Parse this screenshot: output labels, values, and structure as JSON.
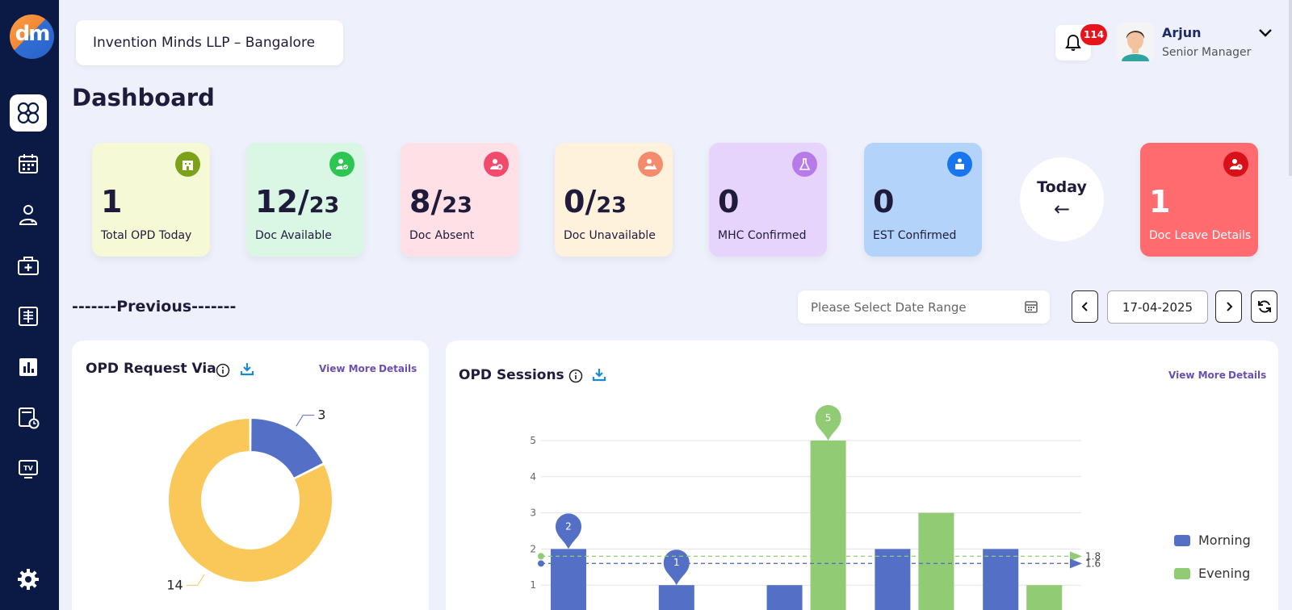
{
  "app": {
    "logo_text": "dm"
  },
  "header": {
    "org_name": "Invention Minds LLP – Bangalore",
    "notification_count": "114",
    "user_name": "Arjun",
    "user_role": "Senior Manager"
  },
  "page_title": "Dashboard",
  "cards": [
    {
      "value": "1",
      "denominator": "",
      "label": "Total OPD Today",
      "bg": "#f6f9d6",
      "icon_bg": "#7ca21a"
    },
    {
      "value": "12/",
      "denominator": "23",
      "label": "Doc Available",
      "bg": "#d9f7e4",
      "icon_bg": "#2dc653"
    },
    {
      "value": "8/",
      "denominator": "23",
      "label": "Doc Absent",
      "bg": "#ffe0e6",
      "icon_bg": "#f24a6d"
    },
    {
      "value": "0/",
      "denominator": "23",
      "label": "Doc Unavailable",
      "bg": "#fff2dc",
      "icon_bg": "#f48b6d"
    },
    {
      "value": "0",
      "denominator": "",
      "label": "MHC Confirmed",
      "bg": "#e7d4fd",
      "icon_bg": "#b67be8"
    },
    {
      "value": "0",
      "denominator": "",
      "label": "EST Confirmed",
      "bg": "#b4d3fb",
      "icon_bg": "#1775f0"
    },
    {
      "value": "1",
      "denominator": "",
      "label": "Doc Leave Details",
      "bg": "#ff6b6e",
      "icon_bg": "#d8101a"
    }
  ],
  "today_button": {
    "label": "Today",
    "arrow": "←"
  },
  "previous_label": "-------Previous-------",
  "date_filter": {
    "placeholder": "Please Select Date Range",
    "current_date": "17-04-2025"
  },
  "opd_request": {
    "title": "OPD Request Via",
    "view_more": "View More",
    "details": "Details",
    "labels": {
      "small": "3",
      "large": "14"
    }
  },
  "opd_sessions": {
    "title": "OPD Sessions",
    "view_more": "View More",
    "details": "Details",
    "avg_evening_label": "1.8",
    "avg_morning_label": "1.6"
  },
  "chart_data": [
    {
      "type": "pie",
      "title": "OPD Request Via",
      "values": [
        3,
        14
      ],
      "colors": [
        "#5470c6",
        "#fac858"
      ]
    },
    {
      "type": "bar",
      "title": "OPD Sessions",
      "ylim": [
        0,
        5
      ],
      "yticks": [
        "1",
        "2",
        "3",
        "4",
        "5"
      ],
      "series": [
        {
          "name": "Morning",
          "values": [
            2,
            1,
            1,
            2,
            2
          ],
          "color": "#5470c6",
          "markers": [
            2,
            1
          ]
        },
        {
          "name": "Evening",
          "values": [
            0,
            0,
            5,
            3,
            1
          ],
          "color": "#91cc75",
          "markers": [
            5
          ]
        }
      ],
      "mark_lines": {
        "Morning": 1.6,
        "Evening": 1.8
      },
      "legend": "right"
    }
  ]
}
